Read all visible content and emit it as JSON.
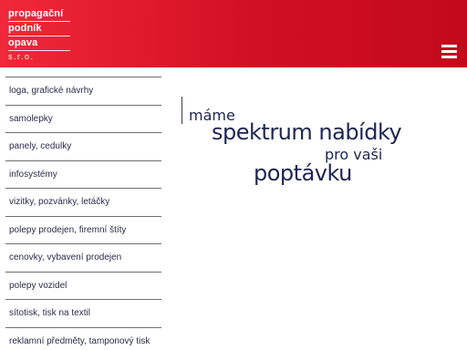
{
  "header": {
    "logo_lines": [
      "propagační",
      "podník",
      "opava"
    ],
    "logo_sro": "s.r.o.",
    "menu_icon": "hamburger-menu-icon",
    "background_color": "#d10f22"
  },
  "nav": {
    "items": [
      {
        "label": "loga, grafické návrhy"
      },
      {
        "label": "samolepky"
      },
      {
        "label": "panely, cedulky"
      },
      {
        "label": "infosystémy"
      },
      {
        "label": "vizitky, pozvánky, letáčky"
      },
      {
        "label": "polepy prodejen, firemní štíty"
      },
      {
        "label": "cenovky, vybavení prodejen"
      },
      {
        "label": "polepy vozidel"
      },
      {
        "label": "sítotisk, tisk na textil"
      },
      {
        "label": "reklamní předměty, tamponový tisk"
      }
    ]
  },
  "hero": {
    "line1": "máme",
    "line2": "spektrum nabídky",
    "line3": "pro vaši",
    "line4": "poptávku"
  }
}
